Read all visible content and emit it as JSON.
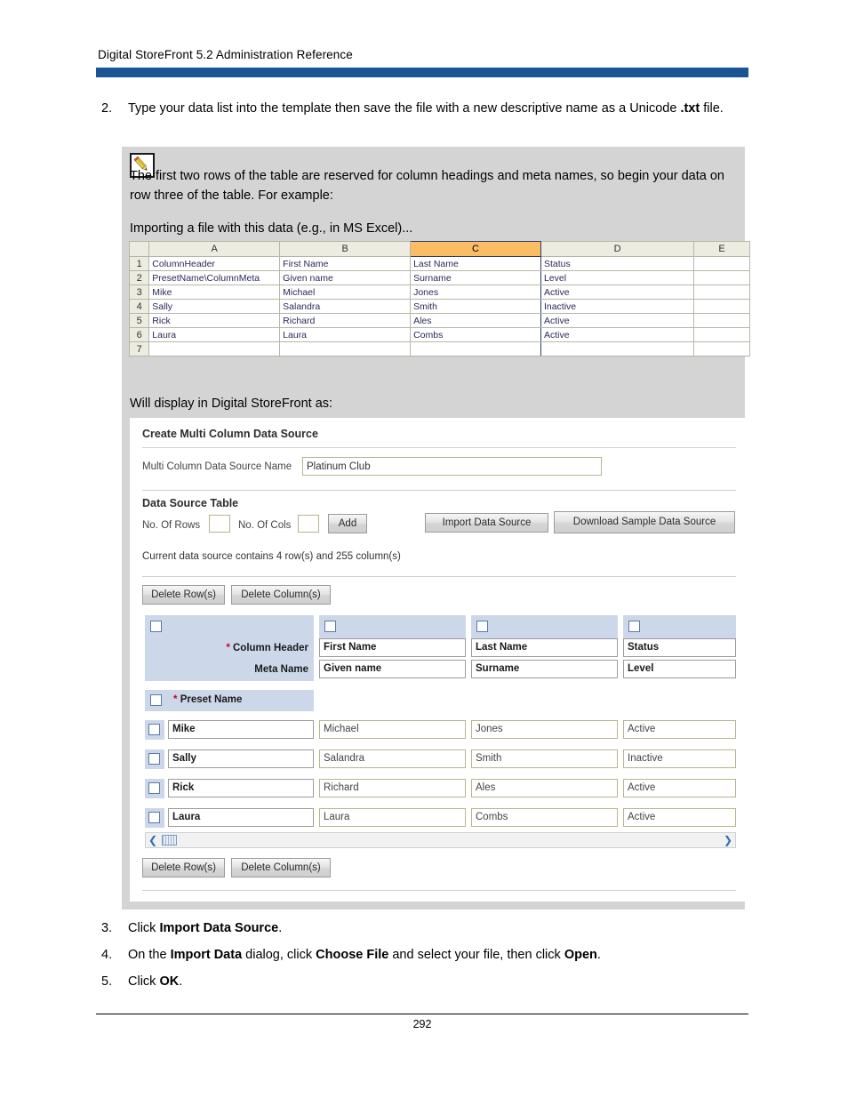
{
  "document": {
    "running_header": "Digital StoreFront 5.2 Administration Reference",
    "page_number": "292"
  },
  "steps": [
    {
      "number": "2.",
      "segments": [
        {
          "text": "Type your data list into the template then save the file with a new descriptive name as a Unicode ",
          "bold": false
        },
        {
          "text": ".txt",
          "bold": true
        },
        {
          "text": " file.",
          "bold": false
        }
      ]
    },
    {
      "number": "3.",
      "segments": [
        {
          "text": "Click ",
          "bold": false
        },
        {
          "text": "Import Data Source",
          "bold": true
        },
        {
          "text": ".",
          "bold": false
        }
      ]
    },
    {
      "number": "4.",
      "segments": [
        {
          "text": "On the ",
          "bold": false
        },
        {
          "text": "Import Data",
          "bold": true
        },
        {
          "text": " dialog, click ",
          "bold": false
        },
        {
          "text": "Choose File",
          "bold": true
        },
        {
          "text": " and select your file, then click ",
          "bold": false
        },
        {
          "text": "Open",
          "bold": true
        },
        {
          "text": ".",
          "bold": false
        }
      ]
    },
    {
      "number": "5.",
      "segments": [
        {
          "text": "Click ",
          "bold": false
        },
        {
          "text": "OK",
          "bold": true
        },
        {
          "text": ".",
          "bold": false
        }
      ]
    }
  ],
  "note": {
    "icon": "pencil-note-icon",
    "text": "The first two rows of the table are reserved for column headings and meta names, so begin your data on row three of the table. For example:",
    "sub_caption": "Importing a file with this data (e.g., in MS Excel)...",
    "will_display_caption": "Will display in Digital StoreFront as:",
    "background_color": "#d4d4d4"
  },
  "excel": {
    "column_letters": [
      "A",
      "B",
      "C",
      "D",
      "E"
    ],
    "selected_column": "C",
    "selected_column_color": "#fbbd63",
    "header_fill": "#ecece0",
    "row_numbers": [
      "1",
      "2",
      "3",
      "4",
      "5",
      "6",
      "7"
    ],
    "rows": [
      [
        "ColumnHeader",
        "First Name",
        "Last Name",
        "Status",
        ""
      ],
      [
        "PresetName\\ColumnMeta",
        "Given name",
        "Surname",
        "Level",
        ""
      ],
      [
        "Mike",
        "Michael",
        "Jones",
        "Active",
        ""
      ],
      [
        "Sally",
        "Salandra",
        "Smith",
        "Inactive",
        ""
      ],
      [
        "Rick",
        "Richard",
        "Ales",
        "Active",
        ""
      ],
      [
        "Laura",
        "Laura",
        "Combs",
        "Active",
        ""
      ],
      [
        "",
        "",
        "",
        "",
        ""
      ]
    ]
  },
  "app": {
    "title": "Create Multi Column Data Source",
    "name_field": {
      "label": "Multi Column Data Source Name",
      "value": "Platinum Club"
    },
    "data_source_table": {
      "section_title": "Data Source Table",
      "rows_label": "No. Of Rows",
      "rows_value": "",
      "cols_label": "No. Of Cols",
      "cols_value": "",
      "add_button": "Add",
      "import_button": "Import Data Source",
      "download_button": "Download Sample Data Source",
      "status_text": "Current data source contains 4 row(s) and 255 column(s)",
      "delete_rows_button": "Delete Row(s)",
      "delete_cols_button": "Delete Column(s)"
    },
    "grid": {
      "required_marker": "*",
      "column_header_label": "Column Header",
      "meta_name_label": "Meta Name",
      "preset_name_label": "Preset Name",
      "column_headers": [
        "First Name",
        "Last Name",
        "Status"
      ],
      "meta_names": [
        "Given name",
        "Surname",
        "Level"
      ],
      "data_rows": [
        {
          "preset": "Mike",
          "values": [
            "Michael",
            "Jones",
            "Active"
          ]
        },
        {
          "preset": "Sally",
          "values": [
            "Salandra",
            "Smith",
            "Inactive"
          ]
        },
        {
          "preset": "Rick",
          "values": [
            "Richard",
            "Ales",
            "Active"
          ]
        },
        {
          "preset": "Laura",
          "values": [
            "Laura",
            "Combs",
            "Active"
          ]
        }
      ],
      "header_fill": "#ccd7ea",
      "scroll_left_icon": "chevron-left-icon",
      "scroll_right_icon": "chevron-right-icon"
    }
  },
  "theme": {
    "header_rule_color": "#1b5494"
  }
}
